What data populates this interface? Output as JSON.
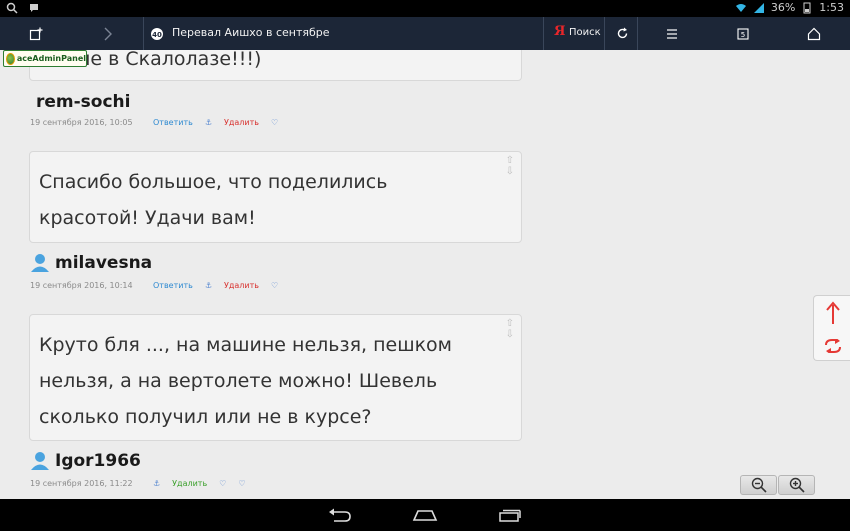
{
  "status_bar": {
    "battery": "36%",
    "time": "1:53"
  },
  "toolbar": {
    "page_title": "Перевал Аишхо в сентябре",
    "search_label": "Поиск",
    "yandex_letter": "Я"
  },
  "admin_badge": {
    "label": "aceAdminPanel"
  },
  "comments": [
    {
      "text_partial": "ионе в Скалолазе!!!)",
      "author": "rem-sochi",
      "date": "19 сентября 2016, 10:05",
      "reply_label": "Ответить",
      "delete_label": "Удалить"
    },
    {
      "text": "Спасибо большое, что поделились красотой! Удачи вам!",
      "author": "milavesna",
      "date": "19 сентября 2016, 10:14",
      "reply_label": "Ответить",
      "delete_label": "Удалить"
    },
    {
      "text": "Круто бля ..., на машине нельзя, пешком нельзя, а на вертолете можно! Шевель сколько получил или не в курсе?",
      "author": "Igor1966",
      "date": "19 сентября 2016, 11:22",
      "delete_label": "Удалить"
    }
  ],
  "colors": {
    "toolbar_bg": "#1c2637",
    "reply_link": "#2f8ad1",
    "delete_link": "#d8322f",
    "delete_link_green": "#3a9f2a",
    "side_arrow": "#e53935"
  }
}
